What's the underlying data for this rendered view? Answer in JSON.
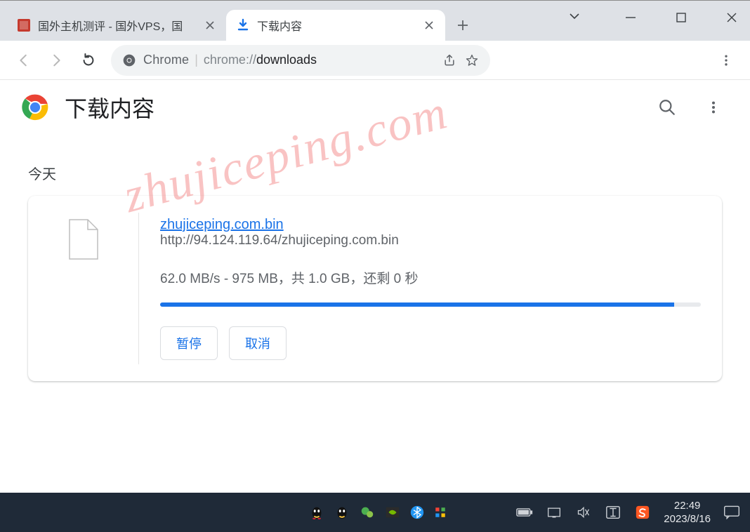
{
  "window": {
    "tabs": [
      {
        "title": "国外主机测评 - 国外VPS，国"
      },
      {
        "title": "下载内容"
      }
    ]
  },
  "toolbar": {
    "chrome_label": "Chrome",
    "url_scheme": "chrome://",
    "url_host": "downloads"
  },
  "downloads": {
    "title": "下载内容",
    "section": "今天",
    "item": {
      "filename": "zhujiceping.com.bin",
      "url": "http://94.124.119.64/zhujiceping.com.bin",
      "status": "62.0 MB/s - 975 MB，共 1.0 GB，还剩 0 秒",
      "progress_pct": 95,
      "pause": "暂停",
      "cancel": "取消"
    }
  },
  "watermark": "zhujiceping.com",
  "taskbar": {
    "time": "22:49",
    "date": "2023/8/16"
  }
}
